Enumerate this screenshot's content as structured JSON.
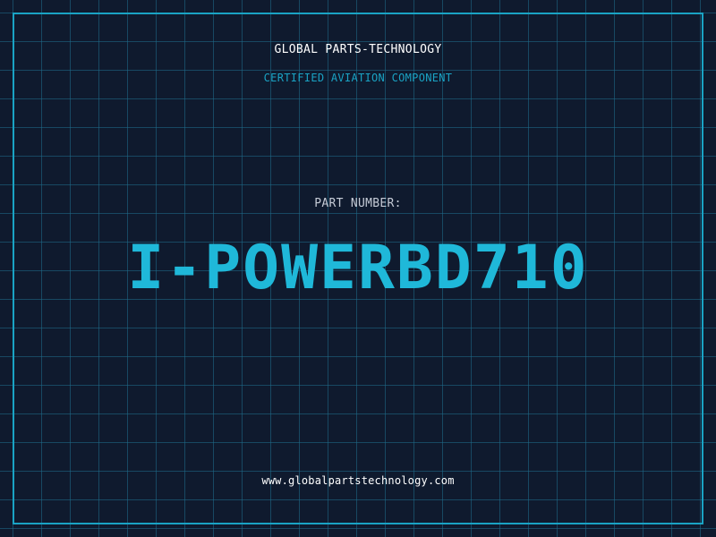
{
  "header": {
    "brand": "GLOBAL PARTS-TECHNOLOGY",
    "tagline": "CERTIFIED AVIATION COMPONENT"
  },
  "main": {
    "part_label": "PART NUMBER:",
    "part_number": "I-POWERBD710"
  },
  "footer": {
    "website": "www.globalpartstechnology.com"
  },
  "colors": {
    "background": "#0f1a2e",
    "accent": "#1aa3c4",
    "part_number": "#1fb8d9"
  }
}
